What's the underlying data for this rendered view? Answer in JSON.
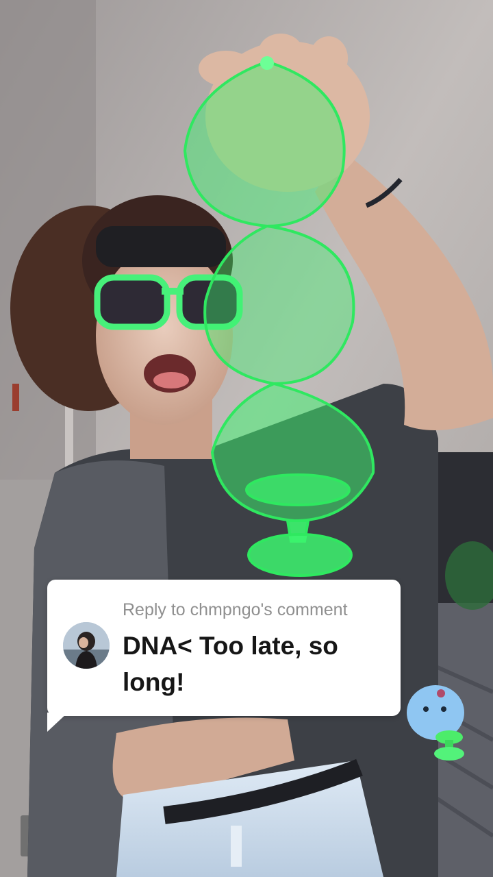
{
  "reply": {
    "header": "Reply to chmpngo's comment",
    "text": "DNA< Too late, so long!"
  },
  "icons": [
    "commenter-avatar"
  ],
  "colors": {
    "card_bg": "#ffffff",
    "header_text": "#8f8f8f",
    "body_text": "#161616",
    "glow_green": "#3cf56e"
  }
}
